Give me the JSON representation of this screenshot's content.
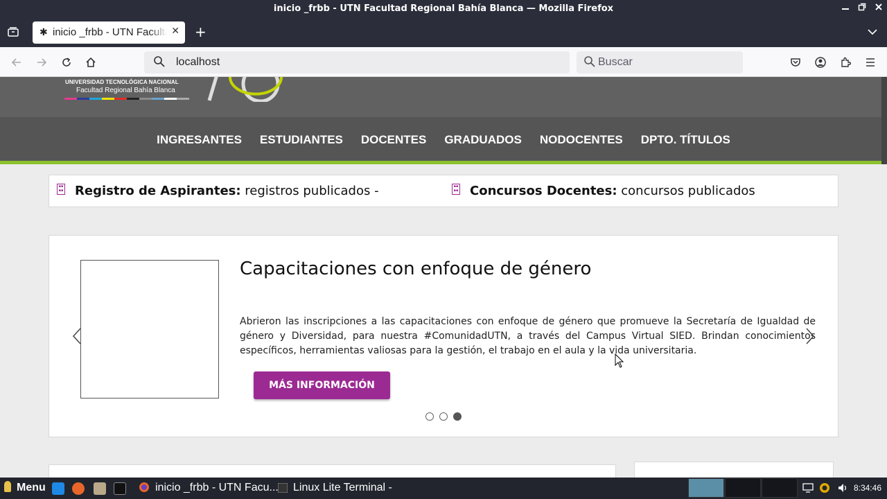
{
  "window": {
    "title": "inicio _frbb - UTN Facultad Regional Bahía Blanca — Mozilla Firefox",
    "minimize_icon": "minimize-icon",
    "maximize_icon": "maximize-icon",
    "close_icon": "close-icon"
  },
  "tabs": [
    {
      "label": "inicio _frbb - UTN Facultad Regional Bahía Blanca",
      "close": "✕"
    }
  ],
  "new_tab": "+",
  "navbar": {
    "url": "localhost",
    "search_placeholder": "Buscar"
  },
  "site": {
    "utn_name": "UNIVERSIDAD TECNOLÓGICA NACIONAL",
    "faculty_name": "Facultad Regional Bahía Blanca",
    "stripe_colors": [
      "#e33b8c",
      "#2c3d9c",
      "#1fa5dc",
      "#f4e400",
      "#e32b2b",
      "#222222",
      "#8b8b8b",
      "#6aa3cf",
      "#ffffff",
      "#aaaaaa"
    ],
    "nav": [
      "INGRESANTES",
      "ESTUDIANTES",
      "DOCENTES",
      "GRADUADOS",
      "NODOCENTES",
      "DPTO. TÍTULOS"
    ],
    "accent_green": "#8bc22d",
    "brand_purple": "#9c2a93"
  },
  "ticker": [
    {
      "label": "Registro de Aspirantes:",
      "text": " registros publicados -"
    },
    {
      "label": "Concursos Docentes:",
      "text": " concursos publicados"
    }
  ],
  "carousel": {
    "title": "Capacitaciones con enfoque de género",
    "text": "Abrieron las inscripciones a las capacitaciones con enfoque de género que promueve la Secretaría de Igualdad de género y Diversidad, para nuestra #ComunidadUTN, a través del Campus Virtual SIED. Brindan conocimientos específicos, herramientas valiosas para la gestión, el trabajo en el aula y la vida universitaria.",
    "button": "MÁS INFORMACIÓN",
    "slide_count": 3,
    "active_slide": 3
  },
  "taskbar": {
    "menu": "Menu",
    "tasks": [
      "inicio _frbb - UTN Facu...",
      "Linux Lite Terminal -"
    ],
    "clock": "8:34:46"
  }
}
